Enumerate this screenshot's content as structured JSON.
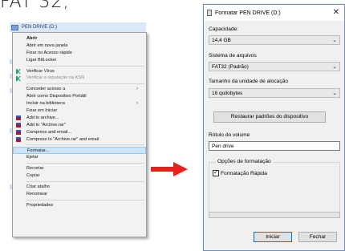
{
  "heading": "FAT 32;",
  "explorer": {
    "drive_label": "PEN DRIVE (D:)"
  },
  "context_menu": {
    "items": [
      {
        "label": "Abrir",
        "style": "bold"
      },
      {
        "label": "Abrir em nova janela"
      },
      {
        "label": "Fixar no Acesso rápido"
      },
      {
        "label": "Ligar BitLocker"
      },
      {
        "sep": true
      },
      {
        "label": "Verificar Vírus",
        "icon": "kaspersky-icon"
      },
      {
        "label": "Verificar a reputação na KSN",
        "icon": "kaspersky-icon",
        "style": "disabled"
      },
      {
        "sep": true
      },
      {
        "label": "Conceder acesso a",
        "submenu": true
      },
      {
        "label": "Abrir como Dispositivo Portátil"
      },
      {
        "label": "Incluir na biblioteca",
        "submenu": true
      },
      {
        "label": "Fixar em Iniciar"
      },
      {
        "label": "Add to archive...",
        "icon": "winrar-icon"
      },
      {
        "label": "Add to \"Archive.rar\"",
        "icon": "winrar-icon"
      },
      {
        "label": "Compress and email...",
        "icon": "winrar-icon"
      },
      {
        "label": "Compress to \"Archive.rar\" and email",
        "icon": "winrar-icon"
      },
      {
        "sep": true
      },
      {
        "label": "Formatar...",
        "style": "selected"
      },
      {
        "label": "Ejetar"
      },
      {
        "sep": true
      },
      {
        "label": "Recortar"
      },
      {
        "label": "Copiar"
      },
      {
        "sep": true
      },
      {
        "label": "Criar atalho"
      },
      {
        "label": "Renomear"
      },
      {
        "sep": true
      },
      {
        "label": "Propriedades"
      }
    ],
    "submenu_glyph": "›"
  },
  "dialog": {
    "title": "Formatar PEN DRIVE (D:)",
    "close_glyph": "✕",
    "capacity_label": "Capacidade:",
    "capacity_value": "14,4 GB",
    "fs_label": "Sistema de arquivos",
    "fs_value": "FAT32 (Padrão)",
    "alloc_label": "Tamanho da unidade de alocação",
    "alloc_value": "16 quilobytes",
    "restore_button": "Restaurar padrões do dispositivo",
    "volume_label": "Rótulo do volume",
    "volume_value": "Pen drive",
    "options_title": "Opções de formatação",
    "quick_format_label": "Formatação Rápida",
    "quick_format_checked": true,
    "check_glyph": "✓",
    "dropdown_glyph": "⌄",
    "start_button": "Iniciar",
    "close_button": "Fechar",
    "progress": 0
  },
  "colors": {
    "arrow": "#e8201d",
    "selection": "#cce4f7",
    "kaspersky": "#1f9e6e",
    "winrar": "#9b1c3c"
  }
}
